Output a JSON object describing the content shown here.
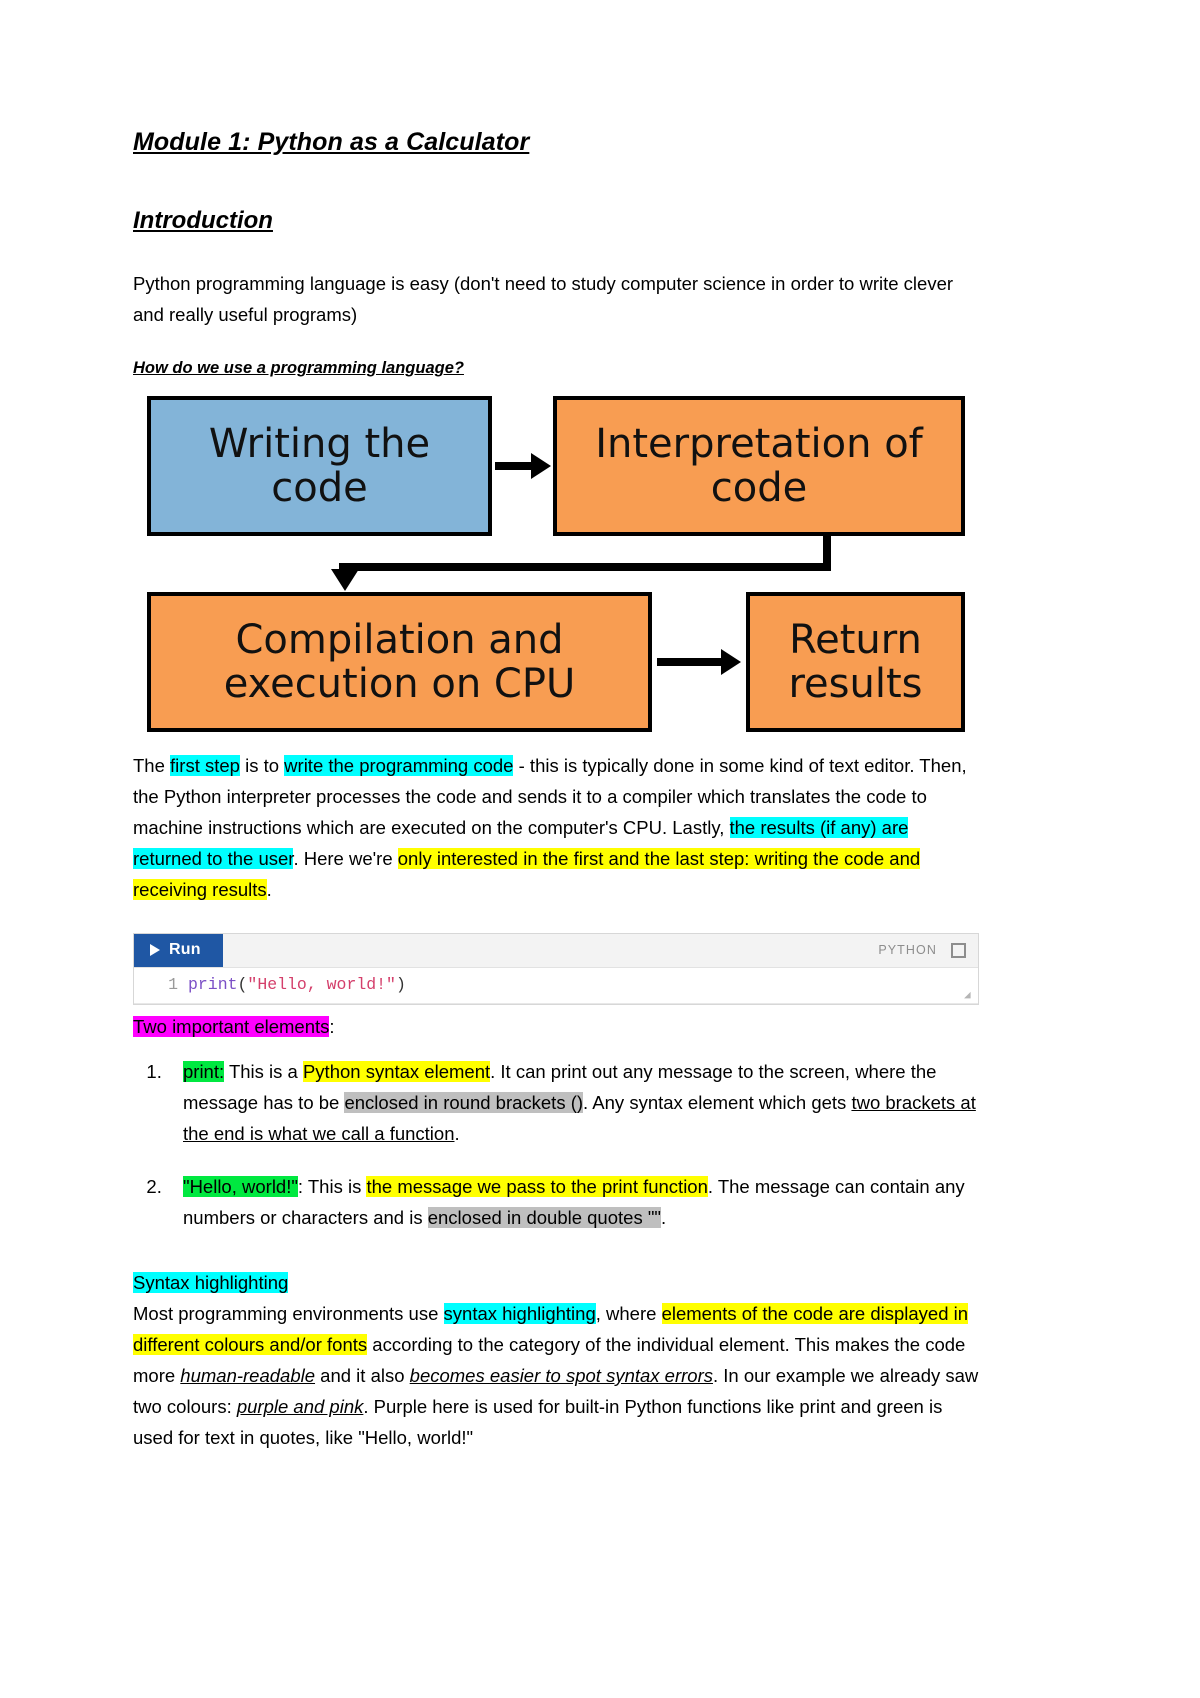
{
  "document": {
    "title": "Module 1: Python as a Calculator",
    "section_heading": "Introduction",
    "intro_paragraph": "Python programming language is easy (don't need to study computer science in order to write clever and really useful programs)",
    "subheading": "How do we use a programming language?"
  },
  "flowchart": {
    "type": "flow",
    "colors": {
      "blue_box": "#83b4d8",
      "orange_box": "#f89d52",
      "border": "#000000"
    },
    "nodes": [
      {
        "id": "write",
        "label": "Writing the code",
        "color": "blue"
      },
      {
        "id": "interpret",
        "label": "Interpretation of code",
        "color": "orange"
      },
      {
        "id": "compile",
        "label": "Compilation and execution on CPU",
        "color": "orange"
      },
      {
        "id": "return",
        "label": "Return results",
        "color": "orange"
      }
    ],
    "edges": [
      {
        "from": "write",
        "to": "interpret",
        "style": "arrow-right"
      },
      {
        "from": "interpret",
        "to": "compile",
        "style": "elbow-down"
      },
      {
        "from": "compile",
        "to": "return",
        "style": "arrow-right"
      }
    ]
  },
  "explanation": {
    "seg1": "The ",
    "seg2_hl_cyan": "first step",
    "seg3": " is to ",
    "seg4_hl_cyan": "write the programming code",
    "seg5": " - this is typically done in some kind of text editor. Then, the Python interpreter processes the code and sends it to a compiler which translates the code to machine instructions which are executed on the computer's CPU. Lastly, ",
    "seg6_hl_cyan": "the results (if any) are returned to the user",
    "seg7": ". Here we're ",
    "seg8_hl_yellow": "only interested in the first and the last step: writing the code and receiving results",
    "seg9": "."
  },
  "code_runner": {
    "run_label": "Run",
    "language_label": "PYTHON",
    "expand_icon": "expand-icon",
    "play_icon": "play-icon",
    "line_number": "1",
    "code_function": "print",
    "code_open_paren": "(",
    "code_string": "\"Hello, world!\"",
    "code_close_paren": ")",
    "accent_color": "#1f57a4"
  },
  "elements_section": {
    "lead_in_hl_magenta": "Two important elements",
    "lead_in_tail": ":",
    "items": [
      {
        "p1_hl_green": "print:",
        "p2": " This is a ",
        "p3_hl_yellow": "Python syntax element",
        "p4": ". It can print out any message to the screen, where the message has to be ",
        "p5_hl_gray": "enclosed in round brackets ()",
        "p6": ". Any syntax element which gets ",
        "p7_underline": "two brackets at the end is what we call a function",
        "p8": "."
      },
      {
        "p1_hl_green": "\"Hello, world!\"",
        "p2": ": This is ",
        "p3_hl_yellow": "the message we pass to the print function",
        "p4": ". The message can contain any numbers or characters and is ",
        "p5_hl_gray": "enclosed in double quotes \"\"",
        "p6": ".",
        "p7_underline": "",
        "p8": ""
      }
    ]
  },
  "syntax_section": {
    "heading_hl_cyan": "Syntax highlighting",
    "s1": "Most programming environments use ",
    "s2_hl_cyan": "syntax highlighting",
    "s3": ", where ",
    "s4_hl_yellow": "elements of the code are displayed in different colours and/or fonts",
    "s5": " according to the category of the individual element. This makes the code more ",
    "s6_underline_italic": "human-readable",
    "s7": " and it also ",
    "s8_underline_italic": "becomes easier to spot syntax errors",
    "s9": ". In our example we already saw two colours: ",
    "s10_underline_italic": "purple and pink",
    "s11": ". Purple here is used for built-in Python functions like print and green is used for text in quotes, like \"Hello, world!\""
  }
}
